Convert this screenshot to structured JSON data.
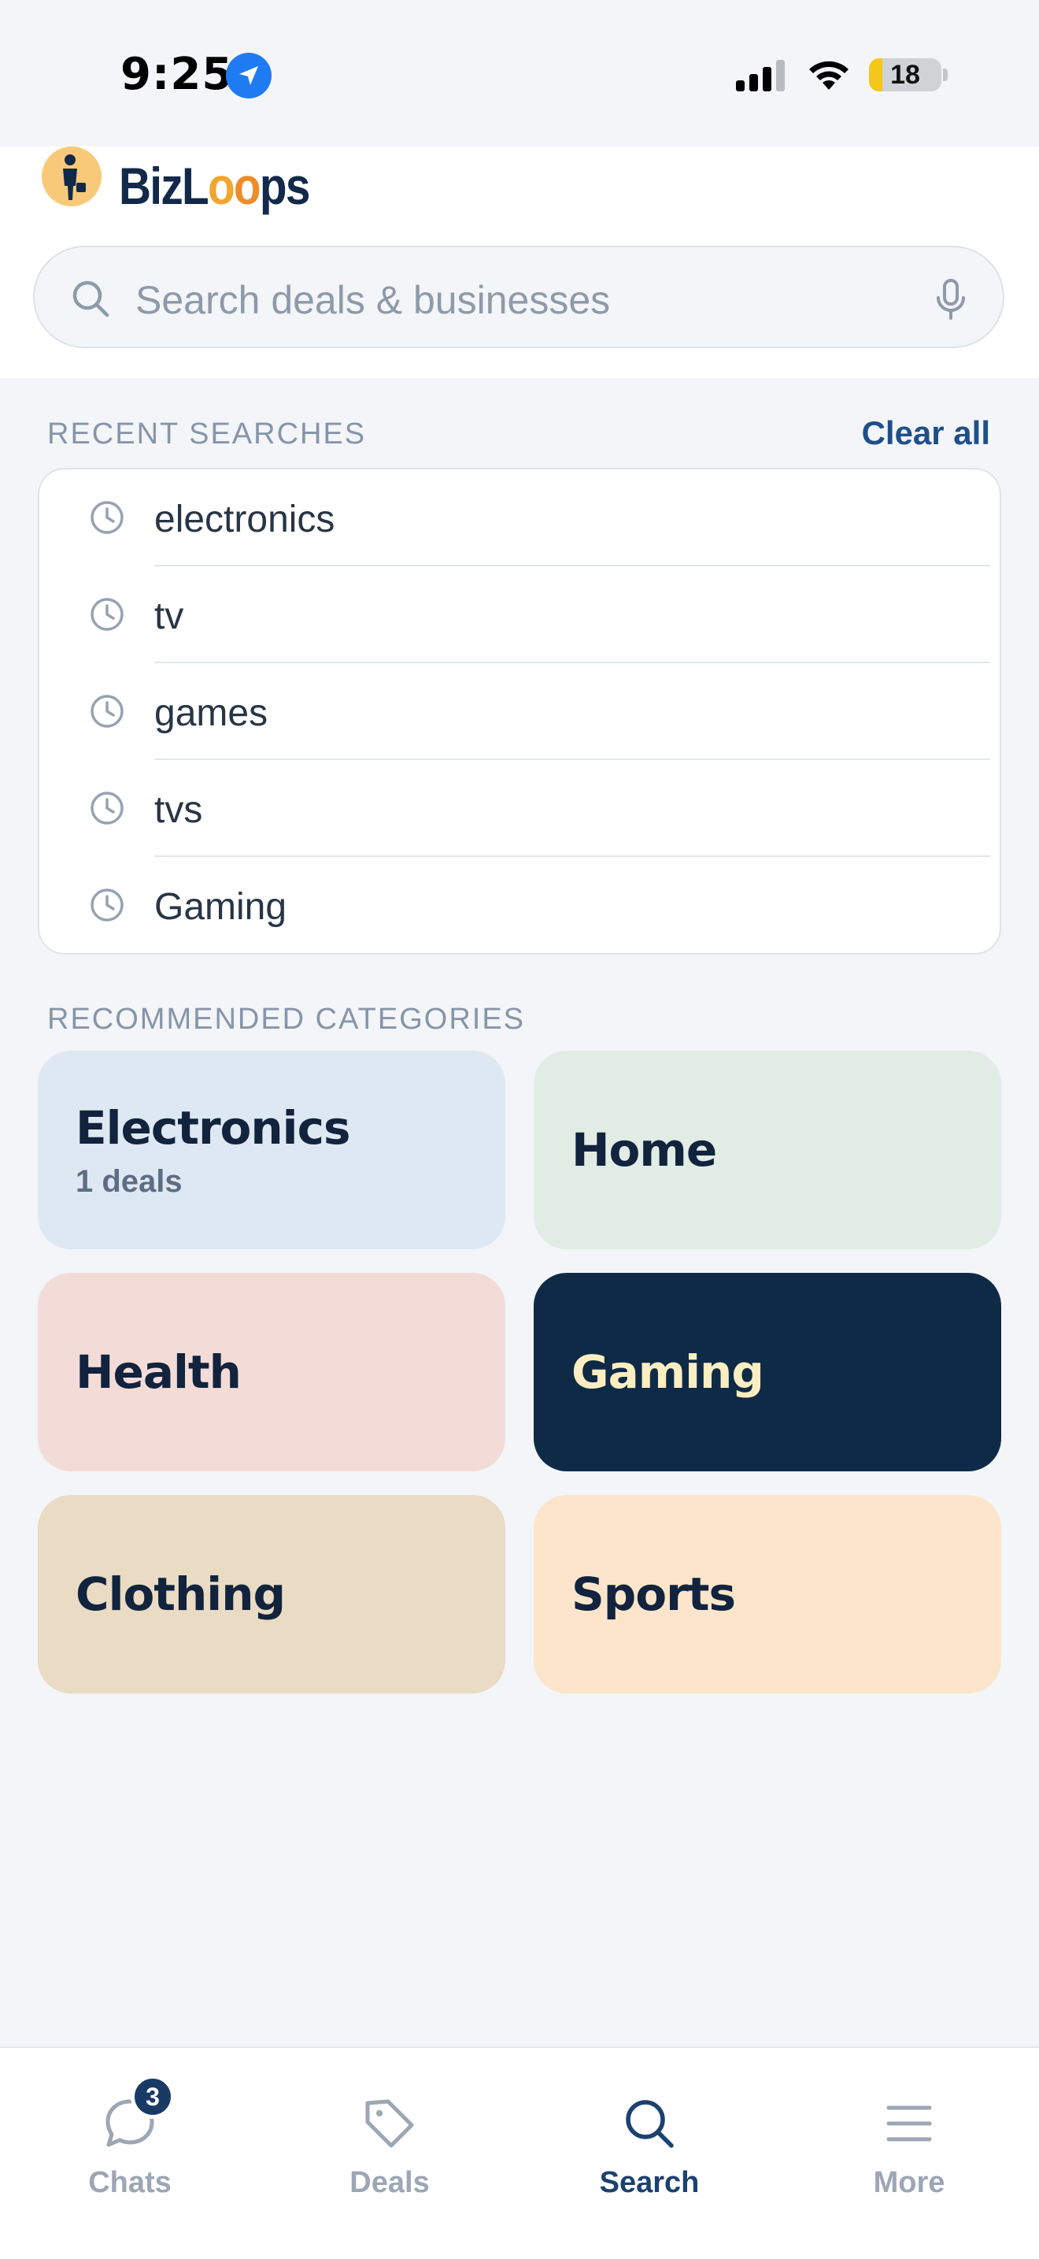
{
  "status_bar": {
    "time": "9:25",
    "battery_level": "18",
    "battery_fraction": 0.18,
    "icons": [
      "location-arrow-icon",
      "cellular-signal-icon",
      "wifi-icon",
      "battery-icon"
    ]
  },
  "header": {
    "logo": {
      "text_a": "BizL",
      "text_o1": "o",
      "text_o2": "o",
      "text_b": "ps",
      "icon": "businessman-logo-icon"
    },
    "search": {
      "placeholder": "Search deals & businesses",
      "icon": "search-icon",
      "voice_icon": "microphone-icon"
    }
  },
  "recent": {
    "title": "RECENT SEARCHES",
    "clear_label": "Clear all",
    "items": [
      {
        "label": "electronics"
      },
      {
        "label": "tv"
      },
      {
        "label": "games"
      },
      {
        "label": "tvs"
      },
      {
        "label": "Gaming"
      }
    ]
  },
  "categories": {
    "title": "RECOMMENDED CATEGORIES",
    "items": [
      {
        "name": "Electronics",
        "subtitle": "1 deals",
        "bg": "#dee8f3",
        "fg": "#11233d"
      },
      {
        "name": "Home",
        "subtitle": "",
        "bg": "#e1ece5",
        "fg": "#11233d"
      },
      {
        "name": "Health",
        "subtitle": "",
        "bg": "#f3dcd8",
        "fg": "#11233d"
      },
      {
        "name": "Gaming",
        "subtitle": "",
        "bg": "#0f2a47",
        "fg": "#fbeec0"
      },
      {
        "name": "Clothing",
        "subtitle": "",
        "bg": "#e9dbc4",
        "fg": "#11233d"
      },
      {
        "name": "Sports",
        "subtitle": "",
        "bg": "#fce5cb",
        "fg": "#11233d"
      }
    ]
  },
  "bottom_nav": {
    "items": [
      {
        "label": "Chats",
        "icon": "chat-bubble-icon",
        "badge": "3",
        "active": false
      },
      {
        "label": "Deals",
        "icon": "tag-icon",
        "badge": "",
        "active": false
      },
      {
        "label": "Search",
        "icon": "search-icon",
        "badge": "",
        "active": true
      },
      {
        "label": "More",
        "icon": "menu-icon",
        "badge": "",
        "active": false
      }
    ]
  },
  "colors": {
    "accent": "#1e4f8a",
    "background": "#f3f5f8",
    "muted_text": "#8795a9"
  }
}
